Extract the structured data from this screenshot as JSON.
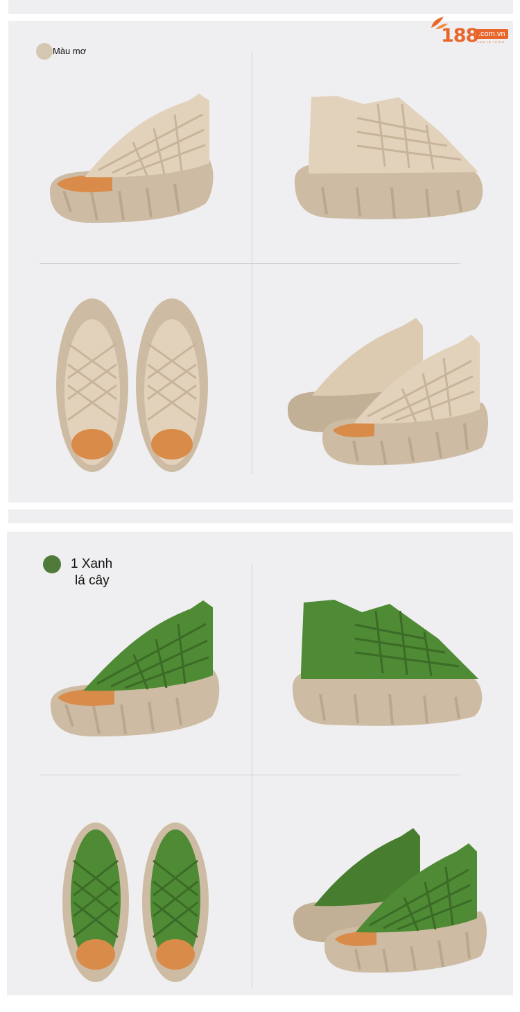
{
  "logo": {
    "number": "188",
    "domain": ".com.vn",
    "tagline": "XEM LÀ THÍCH",
    "color": "#e8662b"
  },
  "sections": [
    {
      "label": "Màu mơ",
      "swatch_color": "#d6c7b3",
      "upper_color": "#e3d2bb",
      "upper_dark": "#c8b49b",
      "sole_color": "#cdbca3",
      "insole_color": "#d98b4a"
    },
    {
      "label_line1": "1 Xanh",
      "label_line2": "lá cây",
      "swatch_color": "#4f7a3a",
      "upper_color": "#4f8a34",
      "upper_dark": "#3b6b27",
      "sole_color": "#cdbca3",
      "insole_color": "#d98b4a"
    }
  ]
}
